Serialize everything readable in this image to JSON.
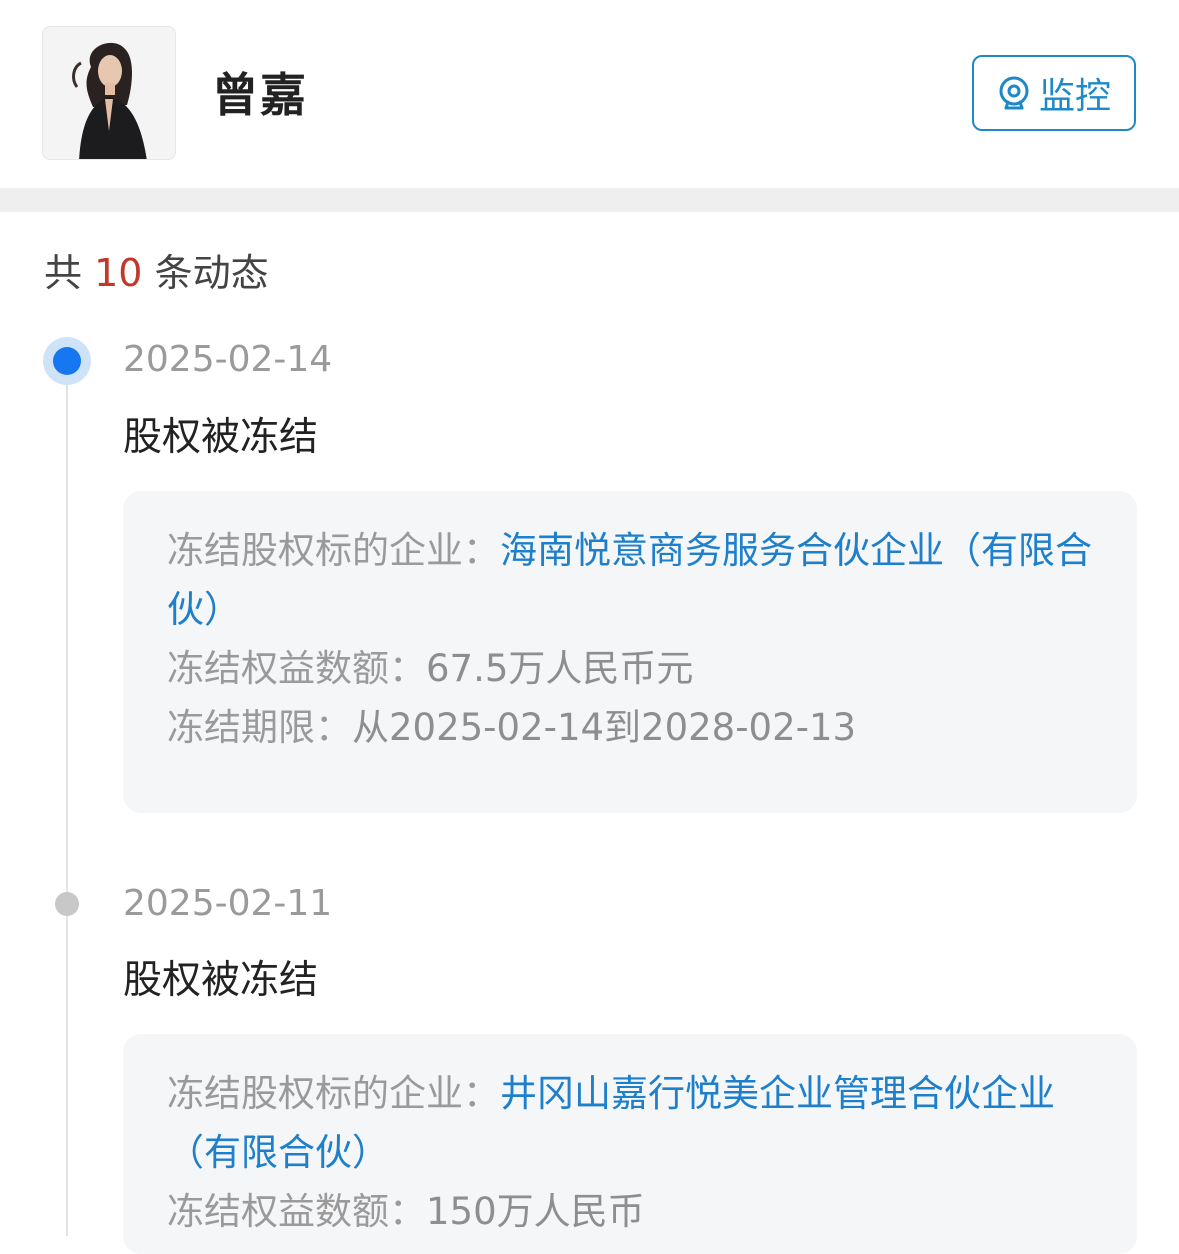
{
  "profile": {
    "name": "曾嘉",
    "monitor_label": "监控"
  },
  "summary": {
    "prefix": "共",
    "count": "10",
    "suffix": "条动态"
  },
  "events": [
    {
      "date": "2025-02-14",
      "title": "股权被冻结",
      "company_label": "冻结股权标的企业：",
      "company": "海南悦意商务服务合伙企业（有限合伙）",
      "amount_label": "冻结权益数额：",
      "amount": "67.5万人民币元",
      "period_label": "冻结期限：",
      "period": "从2025-02-14到2028-02-13"
    },
    {
      "date": "2025-02-11",
      "title": "股权被冻结",
      "company_label": "冻结股权标的企业：",
      "company": "井冈山嘉行悦美企业管理合伙企业（有限合伙）",
      "amount_label": "冻结权益数额：",
      "amount": "150万人民币"
    }
  ],
  "colors": {
    "accent": "#1e7fcb",
    "count_highlight": "#c0392b",
    "active_dot": "#1677f0"
  },
  "icons": {
    "monitor": "eye-monitor-icon"
  }
}
